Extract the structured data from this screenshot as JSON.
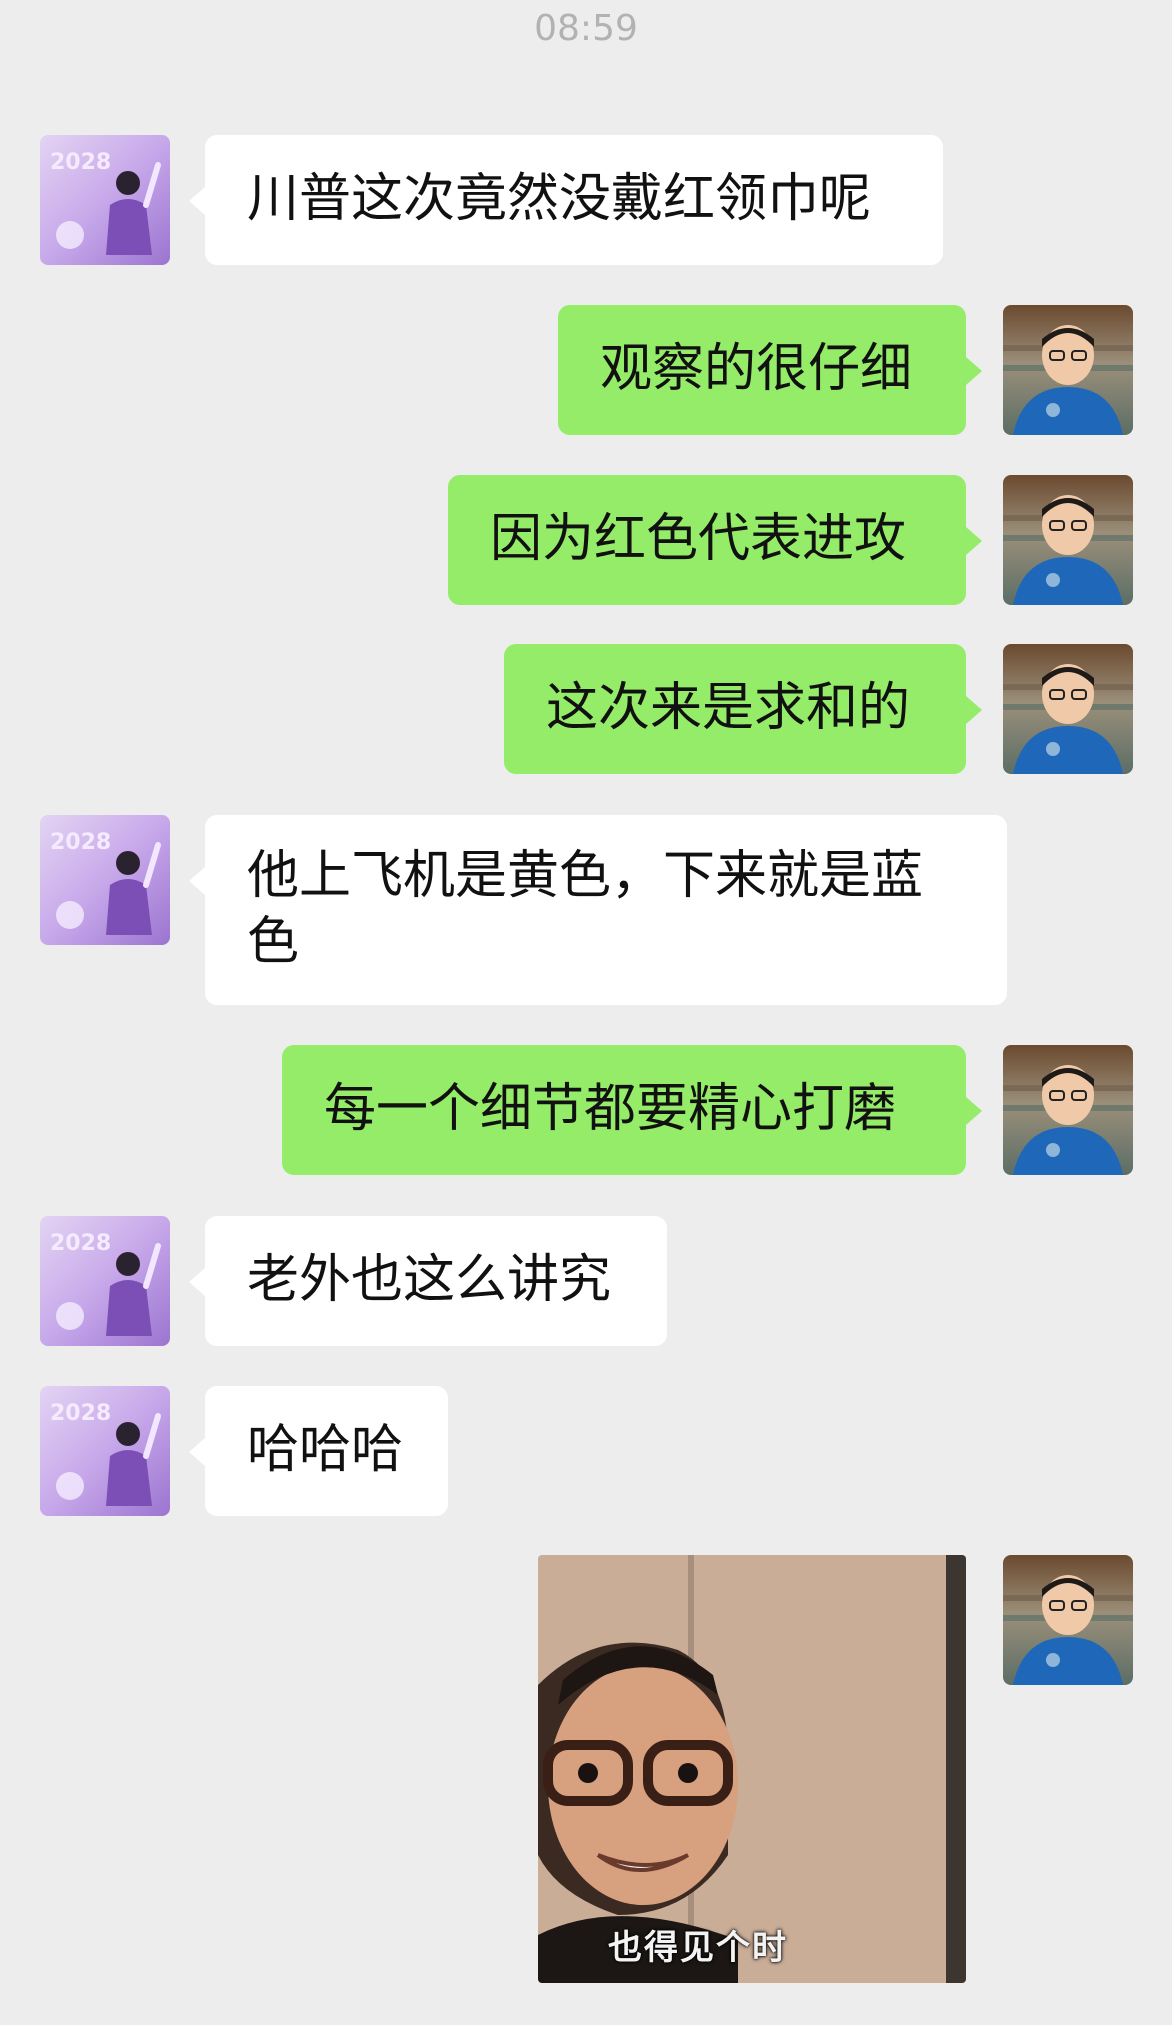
{
  "chat": {
    "timestamp": "08:59",
    "messages": [
      {
        "side": "left",
        "text": "川普这次竟然没戴红领巾呢"
      },
      {
        "side": "right",
        "text": "观察的很仔细"
      },
      {
        "side": "right",
        "text": "因为红色代表进攻"
      },
      {
        "side": "right",
        "text": "这次来是求和的"
      },
      {
        "side": "left",
        "text": "他上飞机是黄色，下来就是蓝色"
      },
      {
        "side": "right",
        "text": "每一个细节都要精心打磨"
      },
      {
        "side": "left",
        "text": "老外也这么讲究"
      },
      {
        "side": "left",
        "text": "哈哈哈"
      }
    ],
    "image_message": {
      "side": "right",
      "caption": "也得见个时"
    }
  },
  "colors": {
    "background": "#ededed",
    "sent_bubble": "#95ec69",
    "received_bubble": "#ffffff",
    "timestamp_text": "#b2b2b2"
  },
  "icons": {
    "left_avatar": "purple-illustrated-avatar",
    "right_avatar": "man-in-blue-shirt-avatar"
  }
}
